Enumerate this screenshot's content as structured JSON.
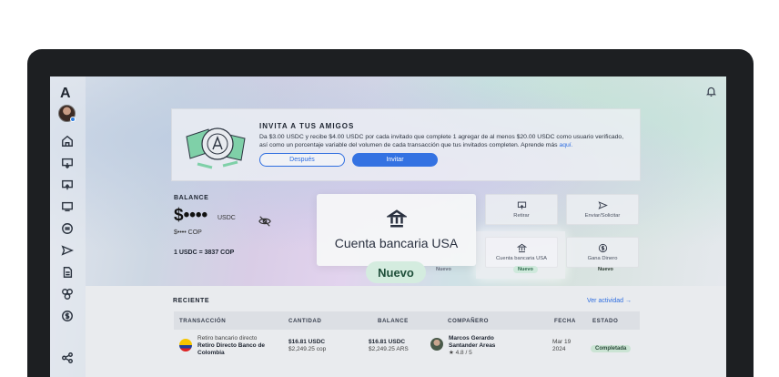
{
  "app": {
    "logo": "A"
  },
  "invite": {
    "title": "INVITA A TUS AMIGOS",
    "text": "Da $3.00 USDC y recibe $4.00 USDC por cada invitado que complete 1 agregar de al menos $20.00 USDC como usuario verificado, así como un porcentaje variable del volumen de cada transacción que tus invitados completen. Aprende más",
    "link": "aquí.",
    "later_button": "Después",
    "invite_button": "Invitar"
  },
  "balance": {
    "label": "BALANCE",
    "amount": "$••••",
    "unit": "USDC",
    "cop": "$•••• COP",
    "rate": "1 USDC = 3837 COP"
  },
  "actions": {
    "withdraw": "Retirar",
    "send": "Enviar/Solicitar",
    "us_account": "Cuenta bancaria USA",
    "earn": "Gana Dinero",
    "new_badge": "Nuevo"
  },
  "overlay": {
    "title": "Cuenta bancaria USA",
    "badge": "Nuevo"
  },
  "recent": {
    "title": "RECIENTE",
    "link": "Ver actividad →",
    "columns": [
      "TRANSACCIÓN",
      "CANTIDAD",
      "BALANCE",
      "COMPAÑERO",
      "FECHA",
      "ESTADO"
    ],
    "row": {
      "type": "Retiro bancario directo",
      "name": "Retiro Directo Banco de Colombia",
      "amount_usdc": "$16.81 USDC",
      "amount_cop": "$2,249.25 cop",
      "balance_usdc": "$16.81 USDC",
      "balance_ars": "$2,249.25 ARS",
      "partner": "Marcos Gerardo Santander Areas",
      "rating": "★ 4.8 / 5",
      "date": "Mar 19 2024",
      "status": "Completada"
    }
  }
}
